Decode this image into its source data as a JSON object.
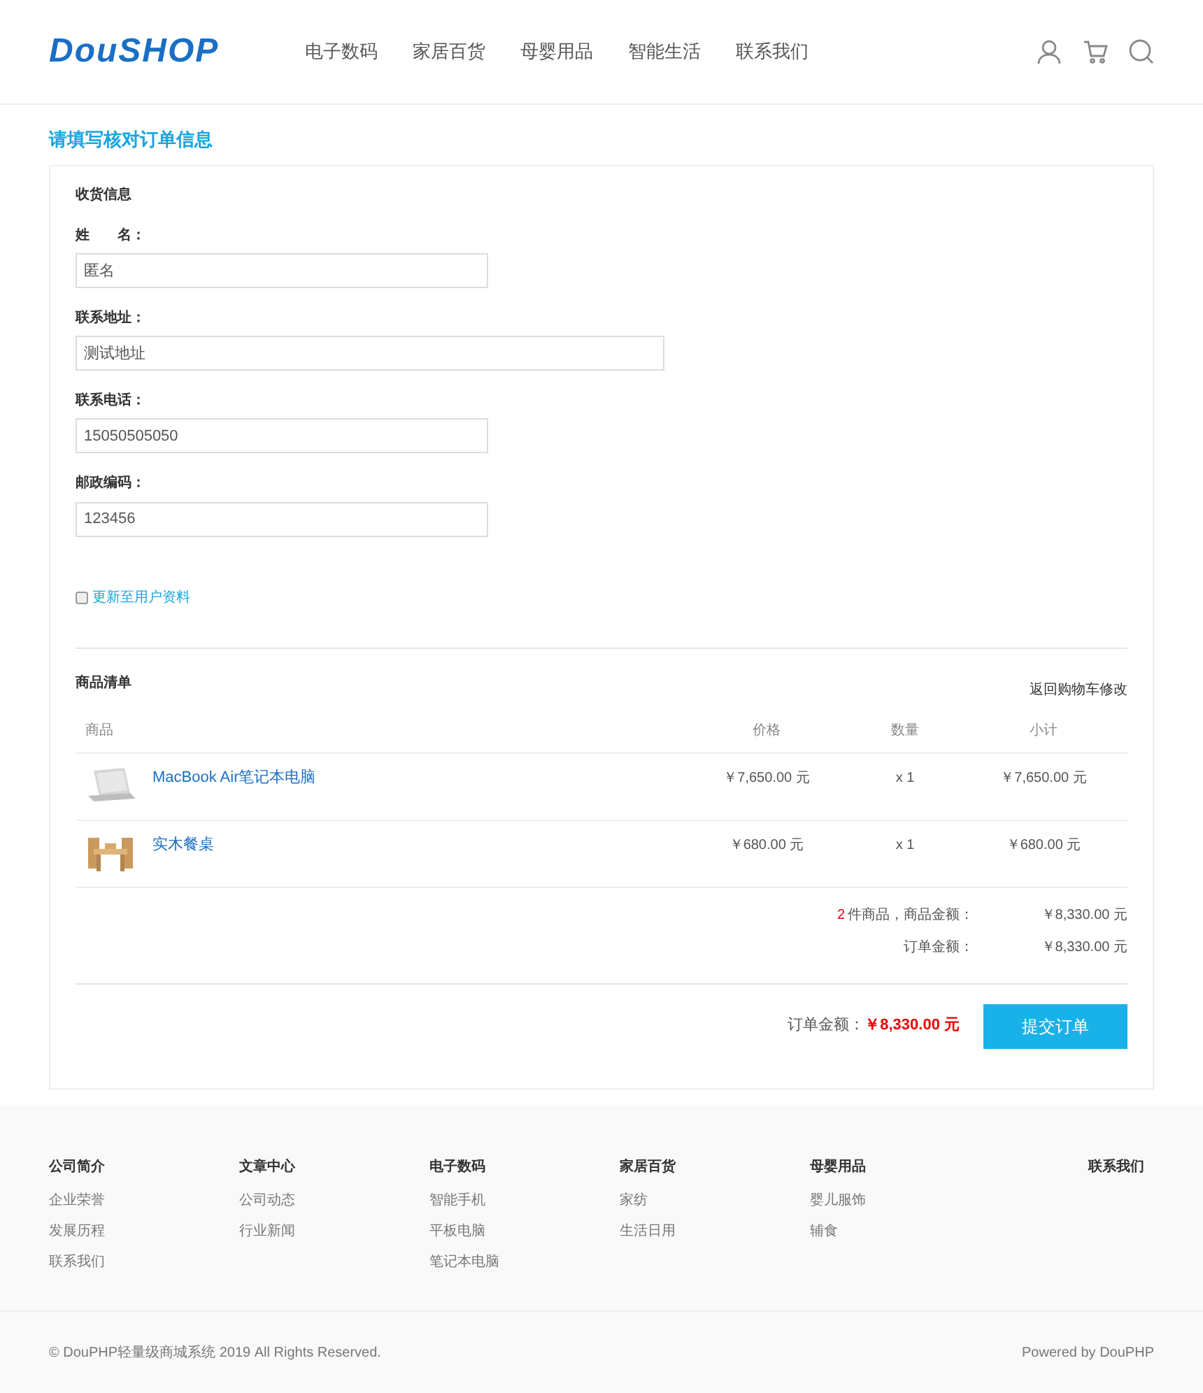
{
  "header": {
    "logo": "DouSHOP",
    "nav": [
      {
        "label": "电子数码"
      },
      {
        "label": "家居百货"
      },
      {
        "label": "母婴用品"
      },
      {
        "label": "智能生活"
      },
      {
        "label": "联系我们"
      }
    ]
  },
  "page_title": "请填写核对订单信息",
  "shipping": {
    "title": "收货信息",
    "fields": [
      {
        "label": "姓　　名：",
        "value": "匿名",
        "wide": false
      },
      {
        "label": "联系地址：",
        "value": "测试地址",
        "wide": true
      },
      {
        "label": "联系电话：",
        "value": "15050505050",
        "wide": false
      },
      {
        "label": "邮政编码：",
        "value": "123456",
        "wide": false
      }
    ],
    "update_profile": {
      "label": "更新至用户资料",
      "checked": false
    }
  },
  "goods": {
    "title": "商品清单",
    "back_link": "返回购物车修改",
    "columns": [
      "商品",
      "价格",
      "数量",
      "小计"
    ],
    "rows": [
      {
        "kind": "laptop",
        "name": "MacBook Air笔记本电脑",
        "price": "￥7,650.00 元",
        "qty": "x 1",
        "subtotal": "￥7,650.00 元"
      },
      {
        "kind": "table",
        "name": "实木餐桌",
        "price": "￥680.00 元",
        "qty": "x 1",
        "subtotal": "￥680.00 元"
      }
    ],
    "summary": [
      {
        "count": "2",
        "label": "件商品，商品金额：",
        "value": "￥8,330.00 元"
      },
      {
        "label": "订单金额：",
        "value": "￥8,330.00 元"
      }
    ],
    "total_label": "订单金额：",
    "total_value": "￥8,330.00 元",
    "submit": "提交订单"
  },
  "footer": {
    "columns": [
      {
        "title": "公司简介",
        "links": [
          "企业荣誉",
          "发展历程",
          "联系我们"
        ]
      },
      {
        "title": "文章中心",
        "links": [
          "公司动态",
          "行业新闻"
        ]
      },
      {
        "title": "电子数码",
        "links": [
          "智能手机",
          "平板电脑",
          "笔记本电脑"
        ]
      },
      {
        "title": "家居百货",
        "links": [
          "家纺",
          "生活日用"
        ]
      },
      {
        "title": "母婴用品",
        "links": [
          "婴儿服饰",
          "辅食"
        ]
      }
    ],
    "contact": "联系我们",
    "copyright": "© DouPHP轻量级商城系统 2019 All Rights Reserved.",
    "powered": "Powered by DouPHP"
  }
}
